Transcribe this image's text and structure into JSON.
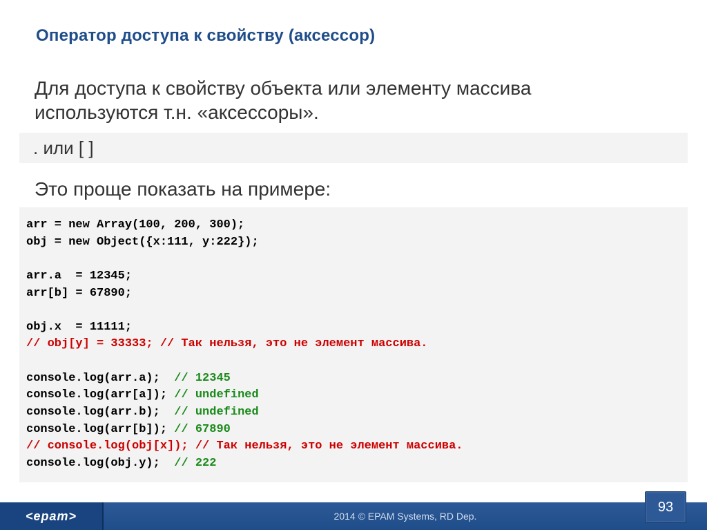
{
  "title": "Оператор доступа к свойству (аксессор)",
  "intro1": "Для доступа к свойству объекта или элементу массива используются т.н. «аксессоры».",
  "gray1": ". или [ ]",
  "intro2": "Это проще показать на примере:",
  "code": {
    "l1": "arr = new Array(100, 200, 300);",
    "l2": "obj = new Object({x:111, y:222});",
    "l3": "",
    "l4": "arr.a  = 12345;",
    "l5": "arr[b] = 67890;",
    "l6": "",
    "l7": "obj.x  = 11111;",
    "l8": "// obj[y] = 33333; // Так нельзя, это не элемент массива.",
    "l9": "",
    "l10a": "console.log(arr.a);  ",
    "l10b": "// 12345",
    "l11a": "console.log(arr[a]); ",
    "l11b": "// undefined",
    "l12a": "console.log(arr.b);  ",
    "l12b": "// undefined",
    "l13a": "console.log(arr[b]); ",
    "l13b": "// 67890",
    "l14": "// console.log(obj[x]); // Так нельзя, это не элемент массива.",
    "l15a": "console.log(obj.y);  ",
    "l15b": "// 222"
  },
  "footer": {
    "logo": "<epam>",
    "copyright": "2014 © EPAM Systems, RD Dep.",
    "page": "93"
  }
}
